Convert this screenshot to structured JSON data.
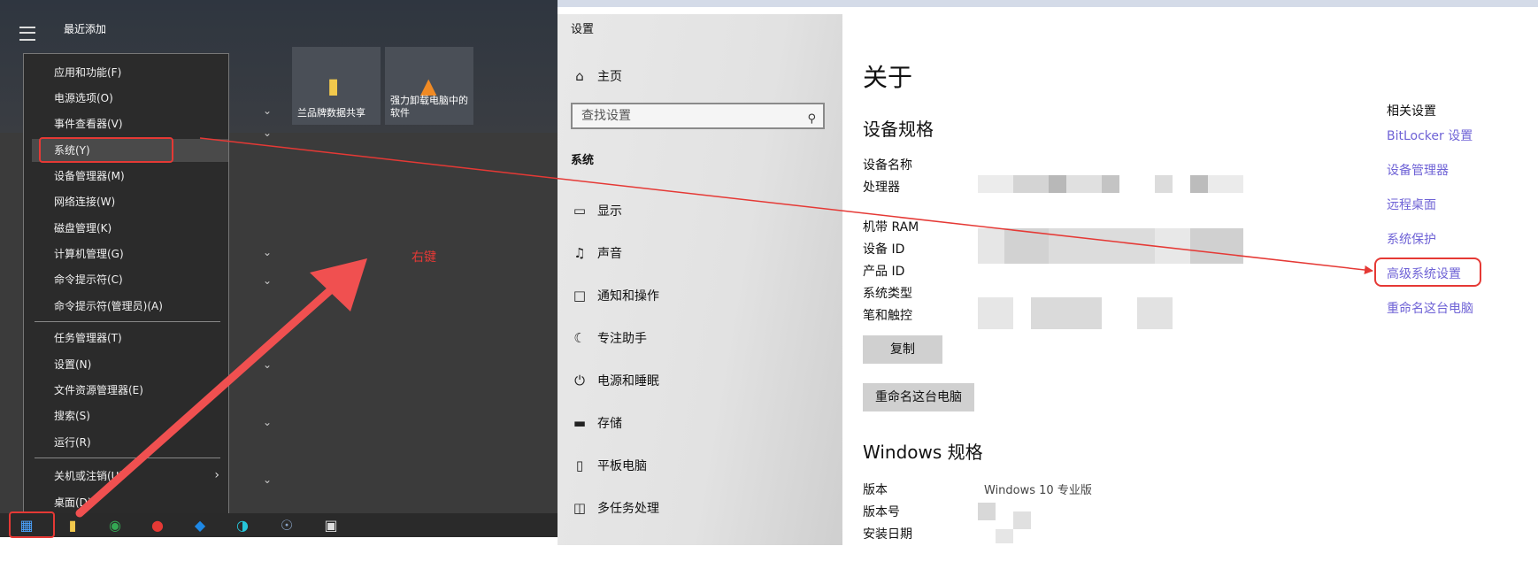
{
  "start_menu": {
    "recent_label": "最近添加",
    "tiles": [
      {
        "label": "兰品牌数据共享",
        "icon": "folder-icon"
      },
      {
        "label": "强力卸载电脑中的软件",
        "icon": "uninstall-icon"
      }
    ],
    "context_menu": {
      "items": [
        {
          "label": "应用和功能(F)"
        },
        {
          "label": "电源选项(O)"
        },
        {
          "label": "事件查看器(V)"
        },
        {
          "label": "系统(Y)"
        },
        {
          "label": "设备管理器(M)"
        },
        {
          "label": "网络连接(W)"
        },
        {
          "label": "磁盘管理(K)"
        },
        {
          "label": "计算机管理(G)"
        },
        {
          "label": "命令提示符(C)"
        },
        {
          "label": "命令提示符(管理员)(A)"
        },
        {
          "label": "任务管理器(T)"
        },
        {
          "label": "设置(N)"
        },
        {
          "label": "文件资源管理器(E)"
        },
        {
          "label": "搜索(S)"
        },
        {
          "label": "运行(R)"
        },
        {
          "label": "关机或注销(U)"
        },
        {
          "label": "桌面(D)"
        }
      ],
      "submenu_arrow": "›"
    },
    "taskbar_icons": [
      "windows-start-icon",
      "file-explorer-icon",
      "chrome-icon",
      "app-icon",
      "shield-app-icon",
      "browser-icon",
      "database-icon",
      "terminal-icon"
    ]
  },
  "annotation": {
    "text": "右键",
    "color": "#e53935"
  },
  "settings": {
    "window_title": "设置",
    "home_label": "主页",
    "search_placeholder": "查找设置",
    "section_label": "系统",
    "nav_items": [
      {
        "label": "显示",
        "icon": "monitor-icon"
      },
      {
        "label": "声音",
        "icon": "speaker-icon"
      },
      {
        "label": "通知和操作",
        "icon": "notification-icon"
      },
      {
        "label": "专注助手",
        "icon": "moon-icon"
      },
      {
        "label": "电源和睡眠",
        "icon": "power-icon"
      },
      {
        "label": "存储",
        "icon": "storage-icon"
      },
      {
        "label": "平板电脑",
        "icon": "tablet-icon"
      },
      {
        "label": "多任务处理",
        "icon": "multitask-icon"
      }
    ],
    "page_title": "关于",
    "device_specs_title": "设备规格",
    "device_spec_labels": [
      "设备名称",
      "处理器",
      "机带 RAM",
      "设备 ID",
      "产品 ID",
      "系统类型",
      "笔和触控"
    ],
    "copy_button": "复制",
    "rename_button": "重命名这台电脑",
    "windows_specs_title": "Windows 规格",
    "windows_spec_labels": [
      "版本",
      "版本号",
      "安装日期"
    ],
    "windows_version_value": "Windows 10 专业版",
    "related": {
      "title": "相关设置",
      "links": [
        "BitLocker 设置",
        "设备管理器",
        "远程桌面",
        "系统保护",
        "高级系统设置",
        "重命名这台电脑"
      ]
    },
    "link_color": "#6f63d6"
  }
}
